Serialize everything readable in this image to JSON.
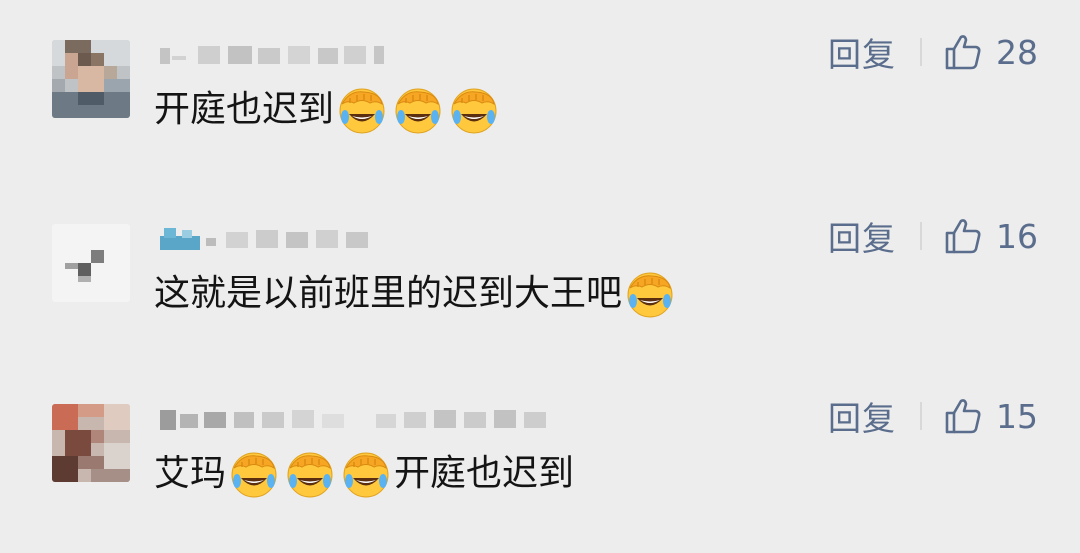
{
  "comments": [
    {
      "text_before": "开庭也迟到",
      "text_after": "",
      "emoji_count": 3,
      "emoji_name": "facepalm-laugh-emoji",
      "reply_label": "回复",
      "like_count": "28"
    },
    {
      "text_before": "这就是以前班里的迟到大王吧",
      "text_after": "",
      "emoji_count": 1,
      "emoji_name": "facepalm-laugh-emoji",
      "reply_label": "回复",
      "like_count": "16"
    },
    {
      "text_before": "艾玛",
      "text_after": "开庭也迟到",
      "emoji_count": 3,
      "emoji_name": "facepalm-laugh-emoji",
      "reply_label": "回复",
      "like_count": "15"
    }
  ],
  "icons": {
    "like": "thumbs-up-outline-icon",
    "emoji": "facepalm-laugh-emoji"
  },
  "colors": {
    "background": "#ededed",
    "text": "#141414",
    "action": "#5a6d8c",
    "divider": "#d8d8d8",
    "emoji_face": "#ffc83d"
  }
}
